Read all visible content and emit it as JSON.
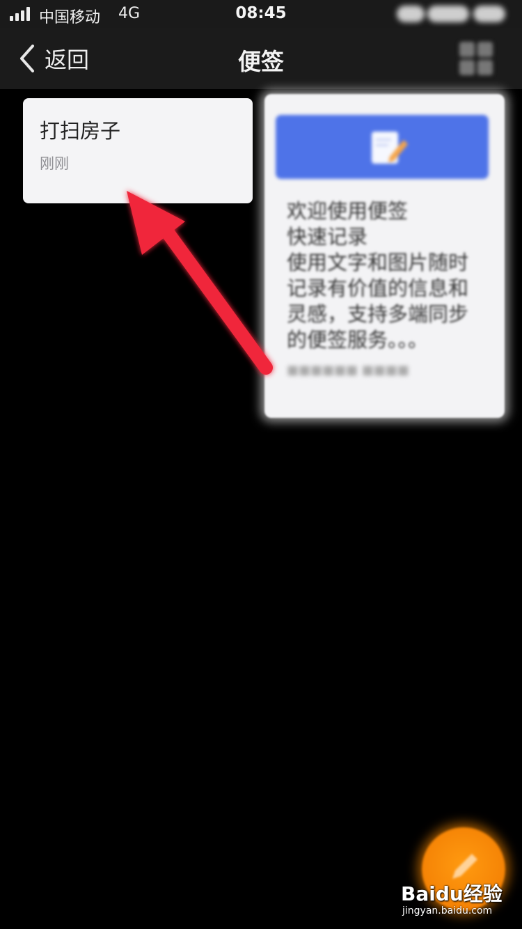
{
  "status_bar": {
    "carrier": "中国移动",
    "network": "4G",
    "time": "08:45"
  },
  "nav": {
    "back_label": "返回",
    "title": "便签"
  },
  "notes": [
    {
      "title": "打扫房子",
      "time": "刚刚"
    }
  ],
  "welcome_note": {
    "lines": [
      "欢迎使用便签",
      "快速记录",
      "使用文字和图片随时",
      "记录有价值的信息和",
      "灵感，支持多端同步",
      "的便签服务。。。"
    ]
  },
  "watermark": {
    "logo": "Baidu经验",
    "url": "jingyan.baidu.com"
  },
  "colors": {
    "accent_blue": "#4e73e8",
    "fab_orange": "#f58a00",
    "arrow_red": "#f0263b"
  }
}
